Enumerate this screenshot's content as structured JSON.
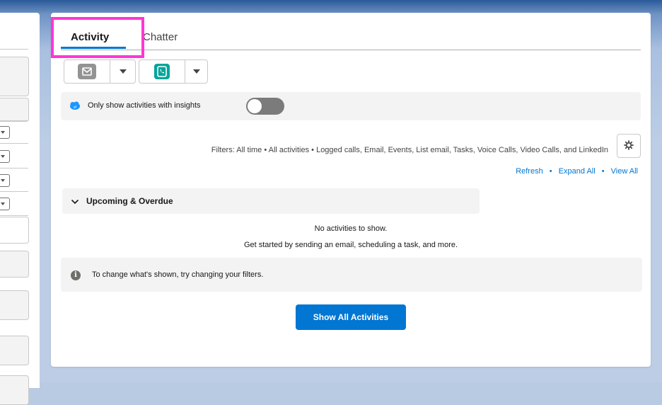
{
  "tabs": [
    {
      "label": "Activity",
      "active": true
    },
    {
      "label": "Chatter",
      "active": false
    }
  ],
  "publisher": {
    "email_icon": "email-icon",
    "call_icon": "log-call-icon",
    "dropdown_icon": "chevron-down-icon"
  },
  "insights": {
    "label": "Only show activities with insights",
    "toggle_on": false
  },
  "filters": {
    "text": "Filters: All time • All activities • Logged calls, Email, Events, List email, Tasks, Voice Calls, Video Calls, and LinkedIn"
  },
  "links": {
    "refresh": "Refresh",
    "expand_all": "Expand All",
    "view_all": "View All",
    "separator": "•"
  },
  "section": {
    "title": "Upcoming & Overdue"
  },
  "empty_state": {
    "line1": "No activities to show.",
    "line2": "Get started by sending an email, scheduling a task, and more."
  },
  "info": {
    "text": "To change what's shown, try changing your filters."
  },
  "buttons": {
    "show_all": "Show All Activities"
  },
  "colors": {
    "brand": "#0176d3",
    "highlight": "#ff36d4",
    "call_teal": "#06a59a"
  }
}
